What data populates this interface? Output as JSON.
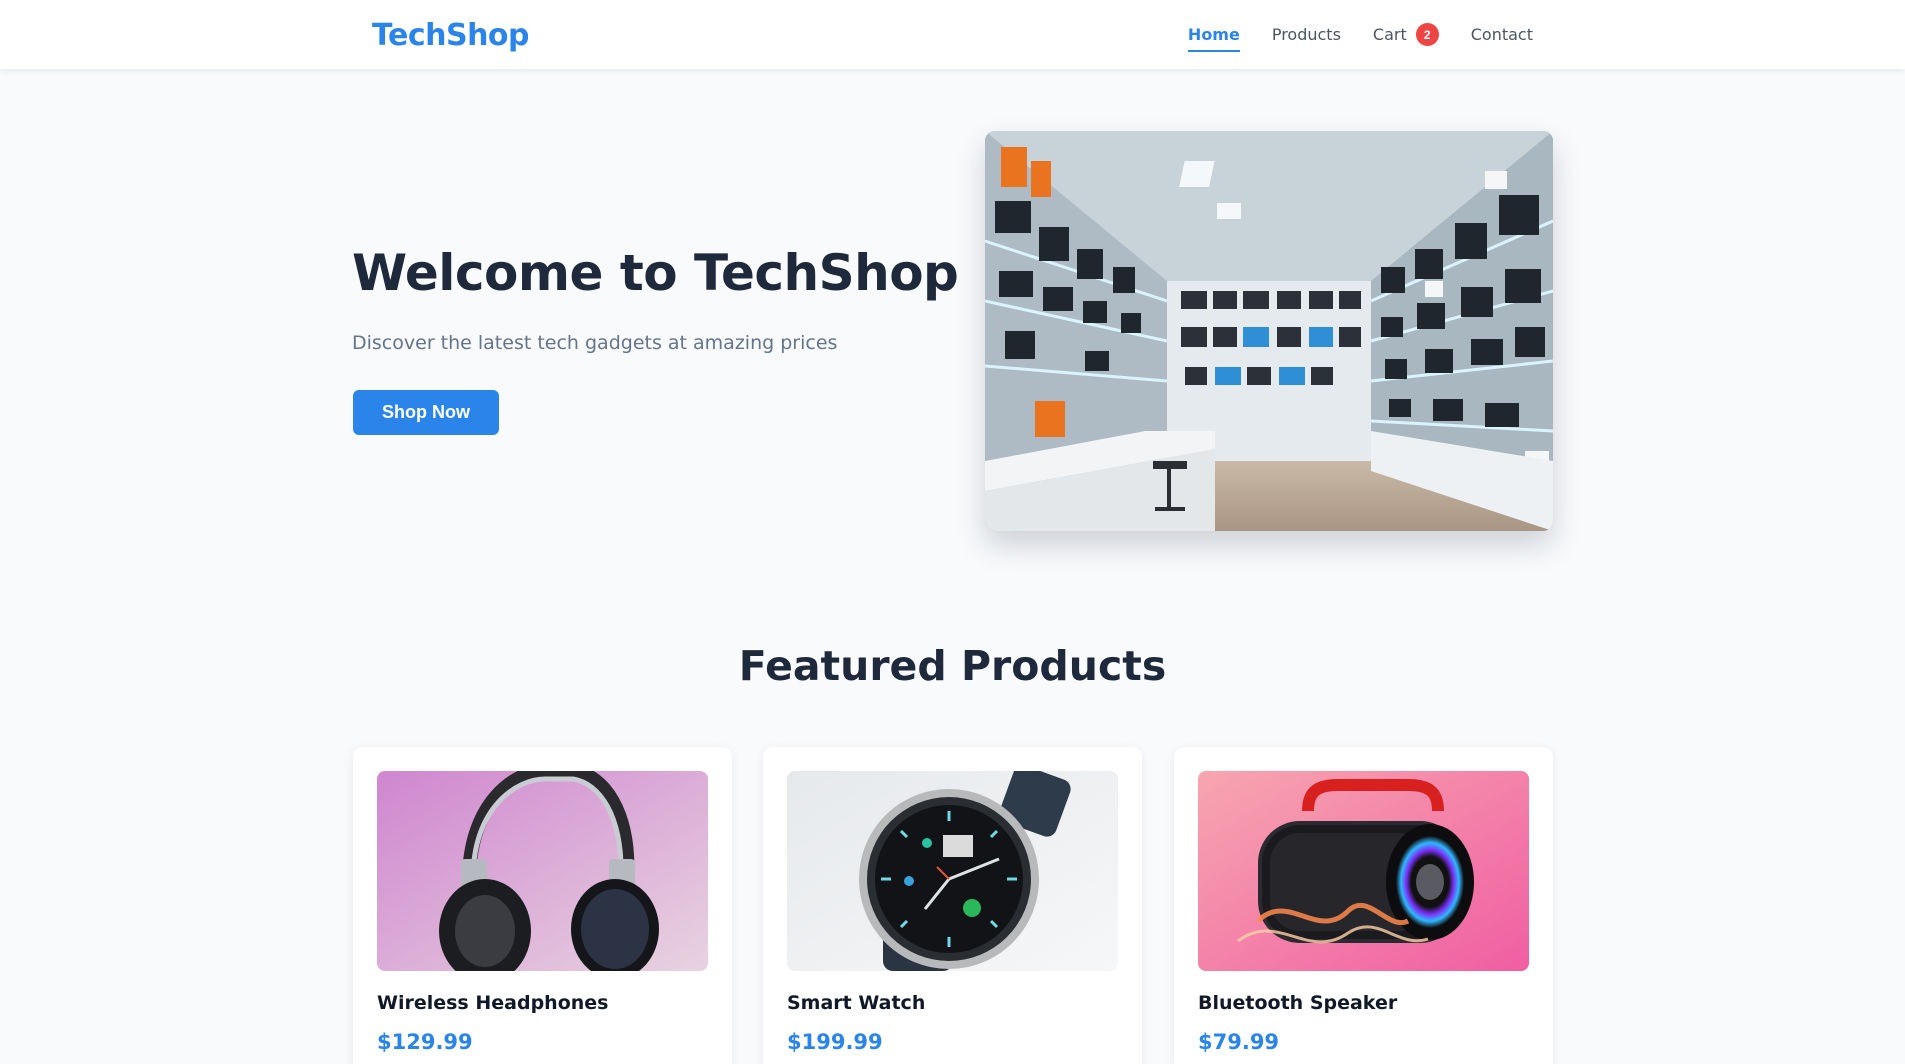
{
  "header": {
    "brand": "TechShop",
    "nav": [
      {
        "label": "Home",
        "active": true
      },
      {
        "label": "Products",
        "active": false
      },
      {
        "label": "Cart",
        "active": false,
        "badge": "2"
      },
      {
        "label": "Contact",
        "active": false
      }
    ]
  },
  "hero": {
    "title": "Welcome to TechShop",
    "subtitle": "Discover the latest tech gadgets at amazing prices",
    "cta_label": "Shop Now",
    "image_icon": "electronics-store-photo"
  },
  "featured": {
    "title": "Featured Products",
    "products": [
      {
        "name": "Wireless Headphones",
        "price": "$129.99",
        "image_icon": "headphones-photo"
      },
      {
        "name": "Smart Watch",
        "price": "$199.99",
        "image_icon": "smartwatch-photo"
      },
      {
        "name": "Bluetooth Speaker",
        "price": "$79.99",
        "image_icon": "speaker-photo"
      }
    ]
  },
  "colors": {
    "accent": "#2b84ea",
    "badge": "#ef4444",
    "page_background": "#f8fafc",
    "heading": "#1e293b"
  }
}
